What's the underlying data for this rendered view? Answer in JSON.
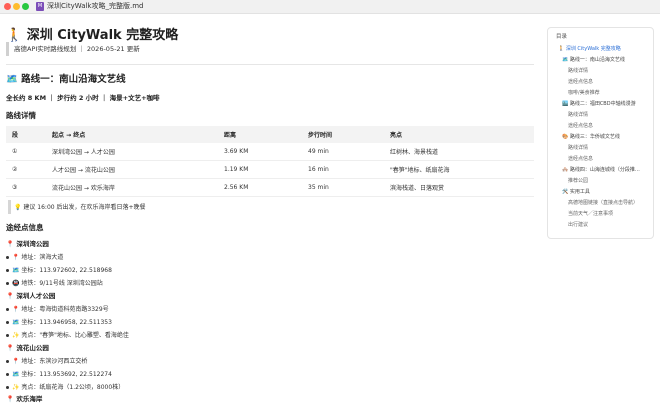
{
  "window": {
    "title": "深圳CityWalk攻略_完整版.md"
  },
  "doc": {
    "title": "🚶 深圳 CityWalk 完整攻略",
    "subtitle": "高德API实时路线规划 ｜ 2026-05-21 更新",
    "route1_heading": "🗺️ 路线一：南山沿海文艺线",
    "route1_summary": "全长约 8 KM ｜ 步行约 2 小时 ｜ 海景+文艺+咖啡",
    "details_heading": "路线详情",
    "table": {
      "headers": [
        "段",
        "起点 → 终点",
        "距离",
        "步行时间",
        "亮点"
      ],
      "rows": [
        [
          "①",
          "深圳湾公园 → 人才公园",
          "3.69 KM",
          "49 min",
          "红树林、海景栈道"
        ],
        [
          "②",
          "人才公园 → 流花山公园",
          "1.19 KM",
          "16 min",
          "\"春笋\"地标、纸扇花海"
        ],
        [
          "③",
          "流花山公园 → 欢乐海岸",
          "2.56 KM",
          "35 min",
          "滨海栈道、日落观赏"
        ]
      ]
    },
    "tip": "💡 建议 16:00 后出发，在欢乐海岸看日落+晚餐",
    "spots_heading": "途经点信息",
    "spots": [
      {
        "name": "📍 深圳湾公园",
        "lines": [
          "📍 地址：滨海大道",
          "🗺️ 坐标：113.972602, 22.518968",
          "🚇 地铁：9/11号线 深圳湾公园站"
        ]
      },
      {
        "name": "📍 深圳人才公园",
        "lines": [
          "📍 地址：粤海街道科苑南路3329号",
          "🗺️ 坐标：113.946958, 22.511353",
          "✨ 亮点：\"春笋\"地标、比心雕塑、看海绝佳"
        ]
      },
      {
        "name": "📍 流花山公园",
        "lines": [
          "📍 地址：东滨沙河西立交桥",
          "🗺️ 坐标：113.953692, 22.512274",
          "✨ 亮点：纸扇花海（1.2公顷，8000株）"
        ]
      },
      {
        "name": "📍 欢乐海岸",
        "lines": []
      }
    ]
  },
  "toc": {
    "label": "目录",
    "items": [
      "🚶 深圳 CityWalk 完整攻略",
      "🗺️ 路线一：南山沿海文艺线",
      "路线详情",
      "途经点信息",
      "咖啡/美食推荐",
      "🏙️ 路线二：福田CBD中轴线漫游",
      "路线详情",
      "途经点信息",
      "🎨 路线三：华侨城文艺线",
      "路线详情",
      "途经点信息",
      "🏘️ 路线四：山海连城线（分段推…",
      "推荐公园",
      "🛠️ 实用工具",
      "高德地图链接（直接点击导航）",
      "当前天气／注意事项",
      "出行建议"
    ]
  }
}
